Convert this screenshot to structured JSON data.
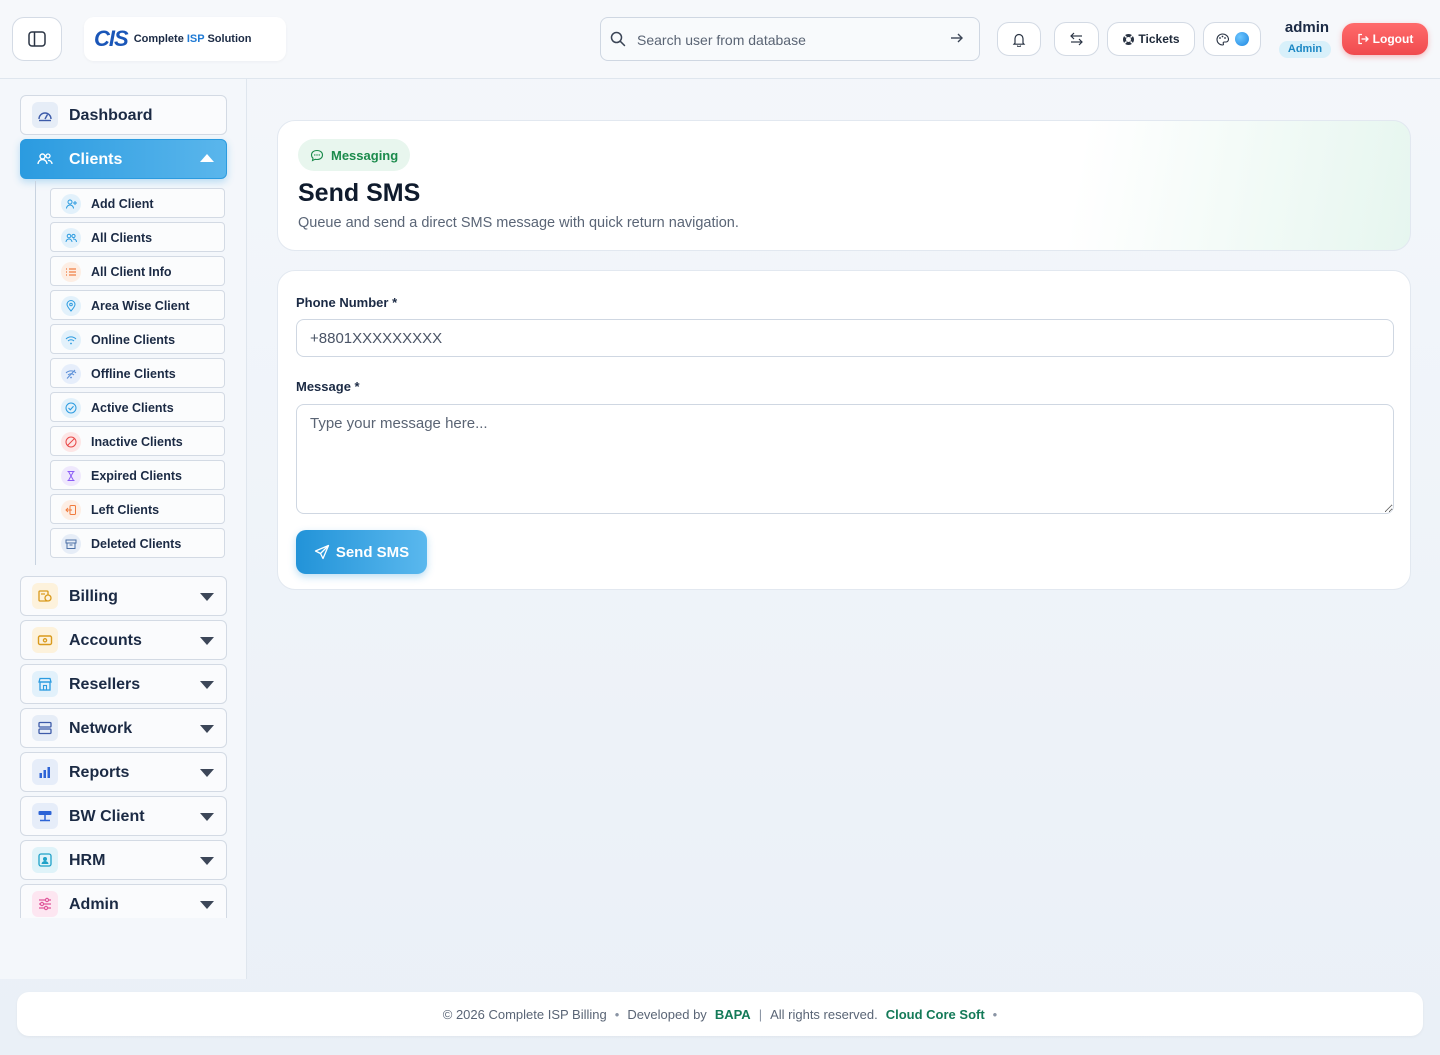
{
  "header": {
    "brand_logo": "CIS",
    "brand_name_pre": "Complete ",
    "brand_name_isp": "ISP",
    "brand_name_post": " Solution",
    "search_placeholder": "Search user from database",
    "tickets_label": "Tickets",
    "user_name": "admin",
    "user_role": "Admin",
    "logout_label": "Logout"
  },
  "sidebar": {
    "dashboard": "Dashboard",
    "clients": "Clients",
    "client_sub": [
      {
        "label": "Add Client",
        "icon": "user-plus-icon",
        "color": "#2b9be0",
        "bg": "#e2f1fb"
      },
      {
        "label": "All Clients",
        "icon": "users-icon",
        "color": "#2b9be0",
        "bg": "#e2f1fb"
      },
      {
        "label": "All Client Info",
        "icon": "list-icon",
        "color": "#f07a3c",
        "bg": "#fdeee4"
      },
      {
        "label": "Area Wise Client",
        "icon": "map-pin-icon",
        "color": "#2b9be0",
        "bg": "#e2f1fb"
      },
      {
        "label": "Online Clients",
        "icon": "wifi-icon",
        "color": "#2b9be0",
        "bg": "#e2f1fb"
      },
      {
        "label": "Offline Clients",
        "icon": "wifi-off-icon",
        "color": "#5b8fd8",
        "bg": "#e6eefb"
      },
      {
        "label": "Active Clients",
        "icon": "check-circle-icon",
        "color": "#2b9be0",
        "bg": "#e2f1fb"
      },
      {
        "label": "Inactive Clients",
        "icon": "ban-icon",
        "color": "#e84848",
        "bg": "#fde6e6"
      },
      {
        "label": "Expired Clients",
        "icon": "hourglass-icon",
        "color": "#8b5cf6",
        "bg": "#efe8fd"
      },
      {
        "label": "Left Clients",
        "icon": "exit-icon",
        "color": "#f07a3c",
        "bg": "#fdeee4"
      },
      {
        "label": "Deleted Clients",
        "icon": "archive-icon",
        "color": "#4a6fa5",
        "bg": "#e6edf7"
      }
    ],
    "groups": [
      {
        "label": "Billing",
        "icon": "billing-icon",
        "color": "#d99a1c",
        "bg": "#fdf2dc"
      },
      {
        "label": "Accounts",
        "icon": "wallet-icon",
        "color": "#d99a1c",
        "bg": "#fdf2dc"
      },
      {
        "label": "Resellers",
        "icon": "store-icon",
        "color": "#2b9be0",
        "bg": "#e2f1fb"
      },
      {
        "label": "Network",
        "icon": "server-icon",
        "color": "#3d5ba9",
        "bg": "#e6edf7"
      },
      {
        "label": "Reports",
        "icon": "bar-chart-icon",
        "color": "#2d64d6",
        "bg": "#e6edf9"
      },
      {
        "label": "BW Client",
        "icon": "network-icon",
        "color": "#2d64d6",
        "bg": "#e6edf9"
      },
      {
        "label": "HRM",
        "icon": "id-card-icon",
        "color": "#1ea1c8",
        "bg": "#dff3f9"
      },
      {
        "label": "Admin",
        "icon": "sliders-icon",
        "color": "#e0559a",
        "bg": "#fde6f1"
      }
    ]
  },
  "main": {
    "badge": "Messaging",
    "title": "Send SMS",
    "subtitle": "Queue and send a direct SMS message with quick return navigation.",
    "phone_label": "Phone Number *",
    "phone_placeholder": "+8801XXXXXXXXX",
    "message_label": "Message *",
    "message_placeholder": "Type your message here...",
    "send_label": "Send SMS"
  },
  "footer": {
    "copyright": "© 2026 Complete ISP Billing",
    "dot": "•",
    "developed_by": "Developed by",
    "developer": "BAPA",
    "pipe": "|",
    "rights": "All rights reserved.",
    "company": "Cloud Core Soft",
    "dot2": "•"
  }
}
